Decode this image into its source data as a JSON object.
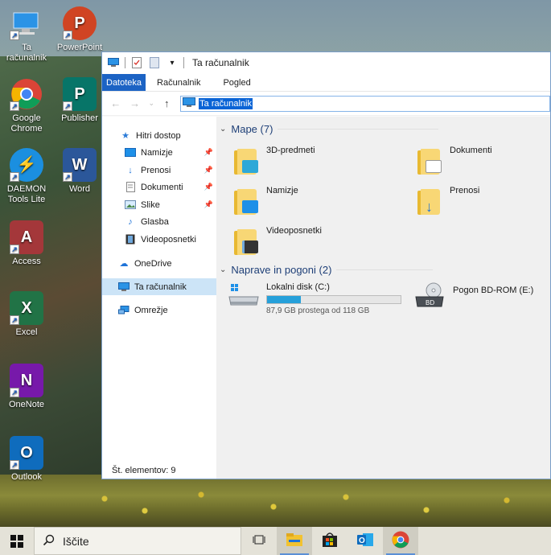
{
  "desktop": {
    "icons": [
      {
        "label": "Ta računalnik",
        "icon": "computer-icon",
        "color": "#2e8ad8"
      },
      {
        "label": "PowerPoint",
        "icon": "powerpoint-icon",
        "color": "#d04423"
      },
      {
        "label": "Google Chrome",
        "icon": "chrome-icon",
        "color": "#34a853"
      },
      {
        "label": "Publisher",
        "icon": "publisher-icon",
        "color": "#077568"
      },
      {
        "label": "DAEMON Tools Lite",
        "icon": "daemon-tools-icon",
        "color": "#1b8fe0"
      },
      {
        "label": "Word",
        "icon": "word-icon",
        "color": "#2b579a"
      },
      {
        "label": "Access",
        "icon": "access-icon",
        "color": "#a4373a"
      },
      {
        "label": "Excel",
        "icon": "excel-icon",
        "color": "#217346"
      },
      {
        "label": "OneNote",
        "icon": "onenote-icon",
        "color": "#7719aa"
      },
      {
        "label": "Outlook",
        "icon": "outlook-icon",
        "color": "#0f6cbd"
      }
    ]
  },
  "window": {
    "title": "Ta računalnik",
    "tabs": [
      "Datoteka",
      "Računalnik",
      "Pogled"
    ],
    "address": "Ta računalnik",
    "nav": {
      "quick_access": "Hitri dostop",
      "quick_items": [
        "Namizje",
        "Prenosi",
        "Dokumenti",
        "Slike",
        "Glasba",
        "Videoposnetki"
      ],
      "onedrive": "OneDrive",
      "this_pc": "Ta računalnik",
      "network": "Omrežje"
    },
    "folders_header": "Mape (7)",
    "folders": [
      "3D-predmeti",
      "Dokumenti",
      "Namizje",
      "Prenosi",
      "Videoposnetki"
    ],
    "drives_header": "Naprave in pogoni (2)",
    "drives": [
      {
        "name": "Lokalni disk (C:)",
        "free": "87,9 GB prostega od 118 GB",
        "used_fraction": 0.255
      },
      {
        "name": "Pogon BD-ROM (E:)"
      }
    ],
    "status": "Št. elementov: 9"
  },
  "taskbar": {
    "search_placeholder": "Iščite"
  },
  "colors": {
    "accent": "#1c63c4",
    "selection": "#cce4f7",
    "header_text": "#1e3f77",
    "drive_bar": "#26a0da"
  }
}
